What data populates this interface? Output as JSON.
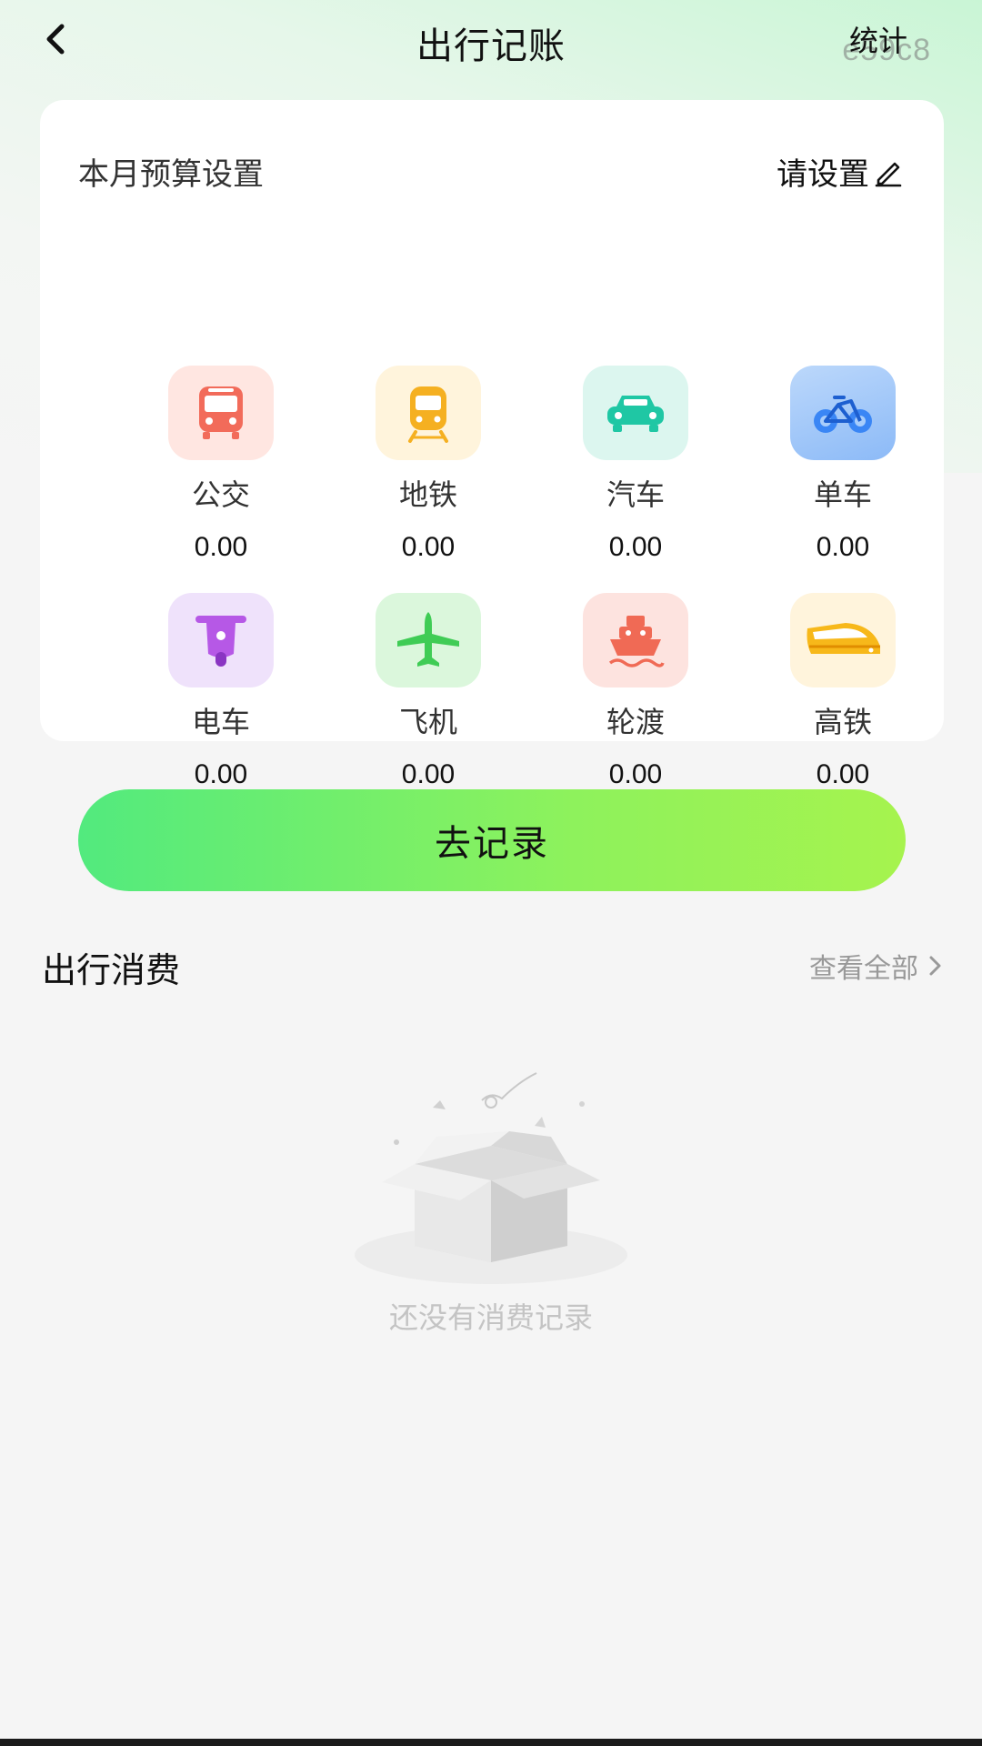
{
  "header": {
    "title": "出行记账",
    "stats_label": "统计",
    "watermark": "e59c8"
  },
  "budget": {
    "title": "本月预算设置",
    "set_label": "请设置"
  },
  "categories": [
    {
      "label": "公交",
      "value": "0.00",
      "icon": "bus-icon",
      "color": "#f26b5a"
    },
    {
      "label": "地铁",
      "value": "0.00",
      "icon": "subway-icon",
      "color": "#f5b021"
    },
    {
      "label": "汽车",
      "value": "0.00",
      "icon": "car-icon",
      "color": "#1fc7a4"
    },
    {
      "label": "单车",
      "value": "0.00",
      "icon": "bicycle-icon",
      "color": "#3a86f5"
    },
    {
      "label": "电车",
      "value": "0.00",
      "icon": "scooter-icon",
      "color": "#b658e6"
    },
    {
      "label": "飞机",
      "value": "0.00",
      "icon": "airplane-icon",
      "color": "#3fcc55"
    },
    {
      "label": "轮渡",
      "value": "0.00",
      "icon": "ferry-icon",
      "color": "#f06a55"
    },
    {
      "label": "高铁",
      "value": "0.00",
      "icon": "high-speed-train-icon",
      "color": "#f7b81a"
    }
  ],
  "record_button": "去记录",
  "expenses": {
    "title": "出行消费",
    "view_all": "查看全部",
    "empty_text": "还没有消费记录"
  }
}
